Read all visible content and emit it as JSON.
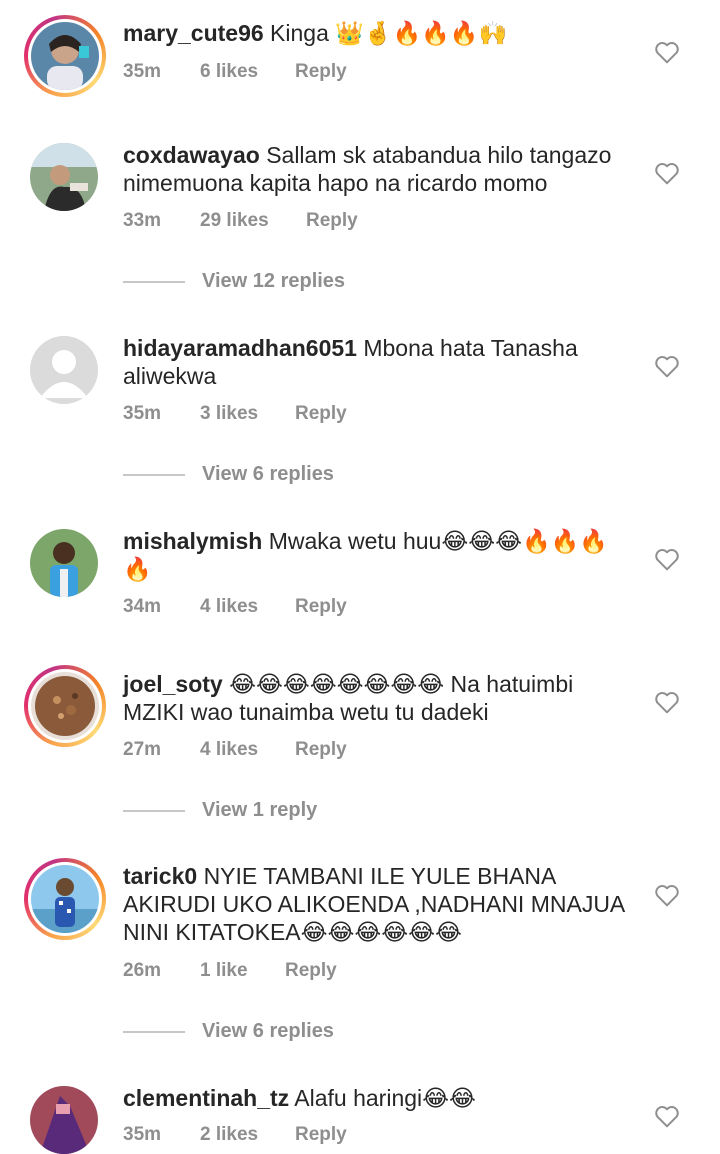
{
  "comments": [
    {
      "username": "mary_cute96",
      "text": "Kinga 👑🤞🔥🔥🔥🙌",
      "time": "35m",
      "likes": "6 likes",
      "reply": "Reply"
    },
    {
      "username": "coxdawayao",
      "text": "Sallam sk atabandua hilo tangazo nimemuona kapita hapo na ricardo momo",
      "time": "33m",
      "likes": "29 likes",
      "reply": "Reply",
      "view_replies": "View 12 replies"
    },
    {
      "username": "hidayaramadhan6051",
      "text": "Mbona hata Tanasha aliwekwa",
      "time": "35m",
      "likes": "3 likes",
      "reply": "Reply",
      "view_replies": "View 6 replies"
    },
    {
      "username": "mishalymish",
      "text": "Mwaka wetu huu😂😂😂🔥🔥🔥🔥",
      "time": "34m",
      "likes": "4 likes",
      "reply": "Reply"
    },
    {
      "username": "joel_soty",
      "text": "😂😂😂😂😂😂😂😂 Na hatuimbi MZIKI wao tunaimba wetu tu dadeki",
      "time": "27m",
      "likes": "4 likes",
      "reply": "Reply",
      "view_replies": "View 1 reply"
    },
    {
      "username": "tarick0",
      "text": "NYIE TAMBANI ILE YULE BHANA AKIRUDI UKO ALIKOENDA ,NADHANI MNAJUA NINI KITATOKEA😂😂😂😂😂😂",
      "time": "26m",
      "likes": "1 like",
      "reply": "Reply",
      "view_replies": "View 6 replies"
    },
    {
      "username": "clementinah_tz",
      "text": "Alafu haringi😂😂",
      "time": "35m",
      "likes": "2 likes",
      "reply": "Reply"
    }
  ],
  "colors": {
    "text": "#262626",
    "muted": "#8e8e8e",
    "story_ring": "#e1306c"
  },
  "icons": {
    "like": "heart-outline-icon"
  }
}
